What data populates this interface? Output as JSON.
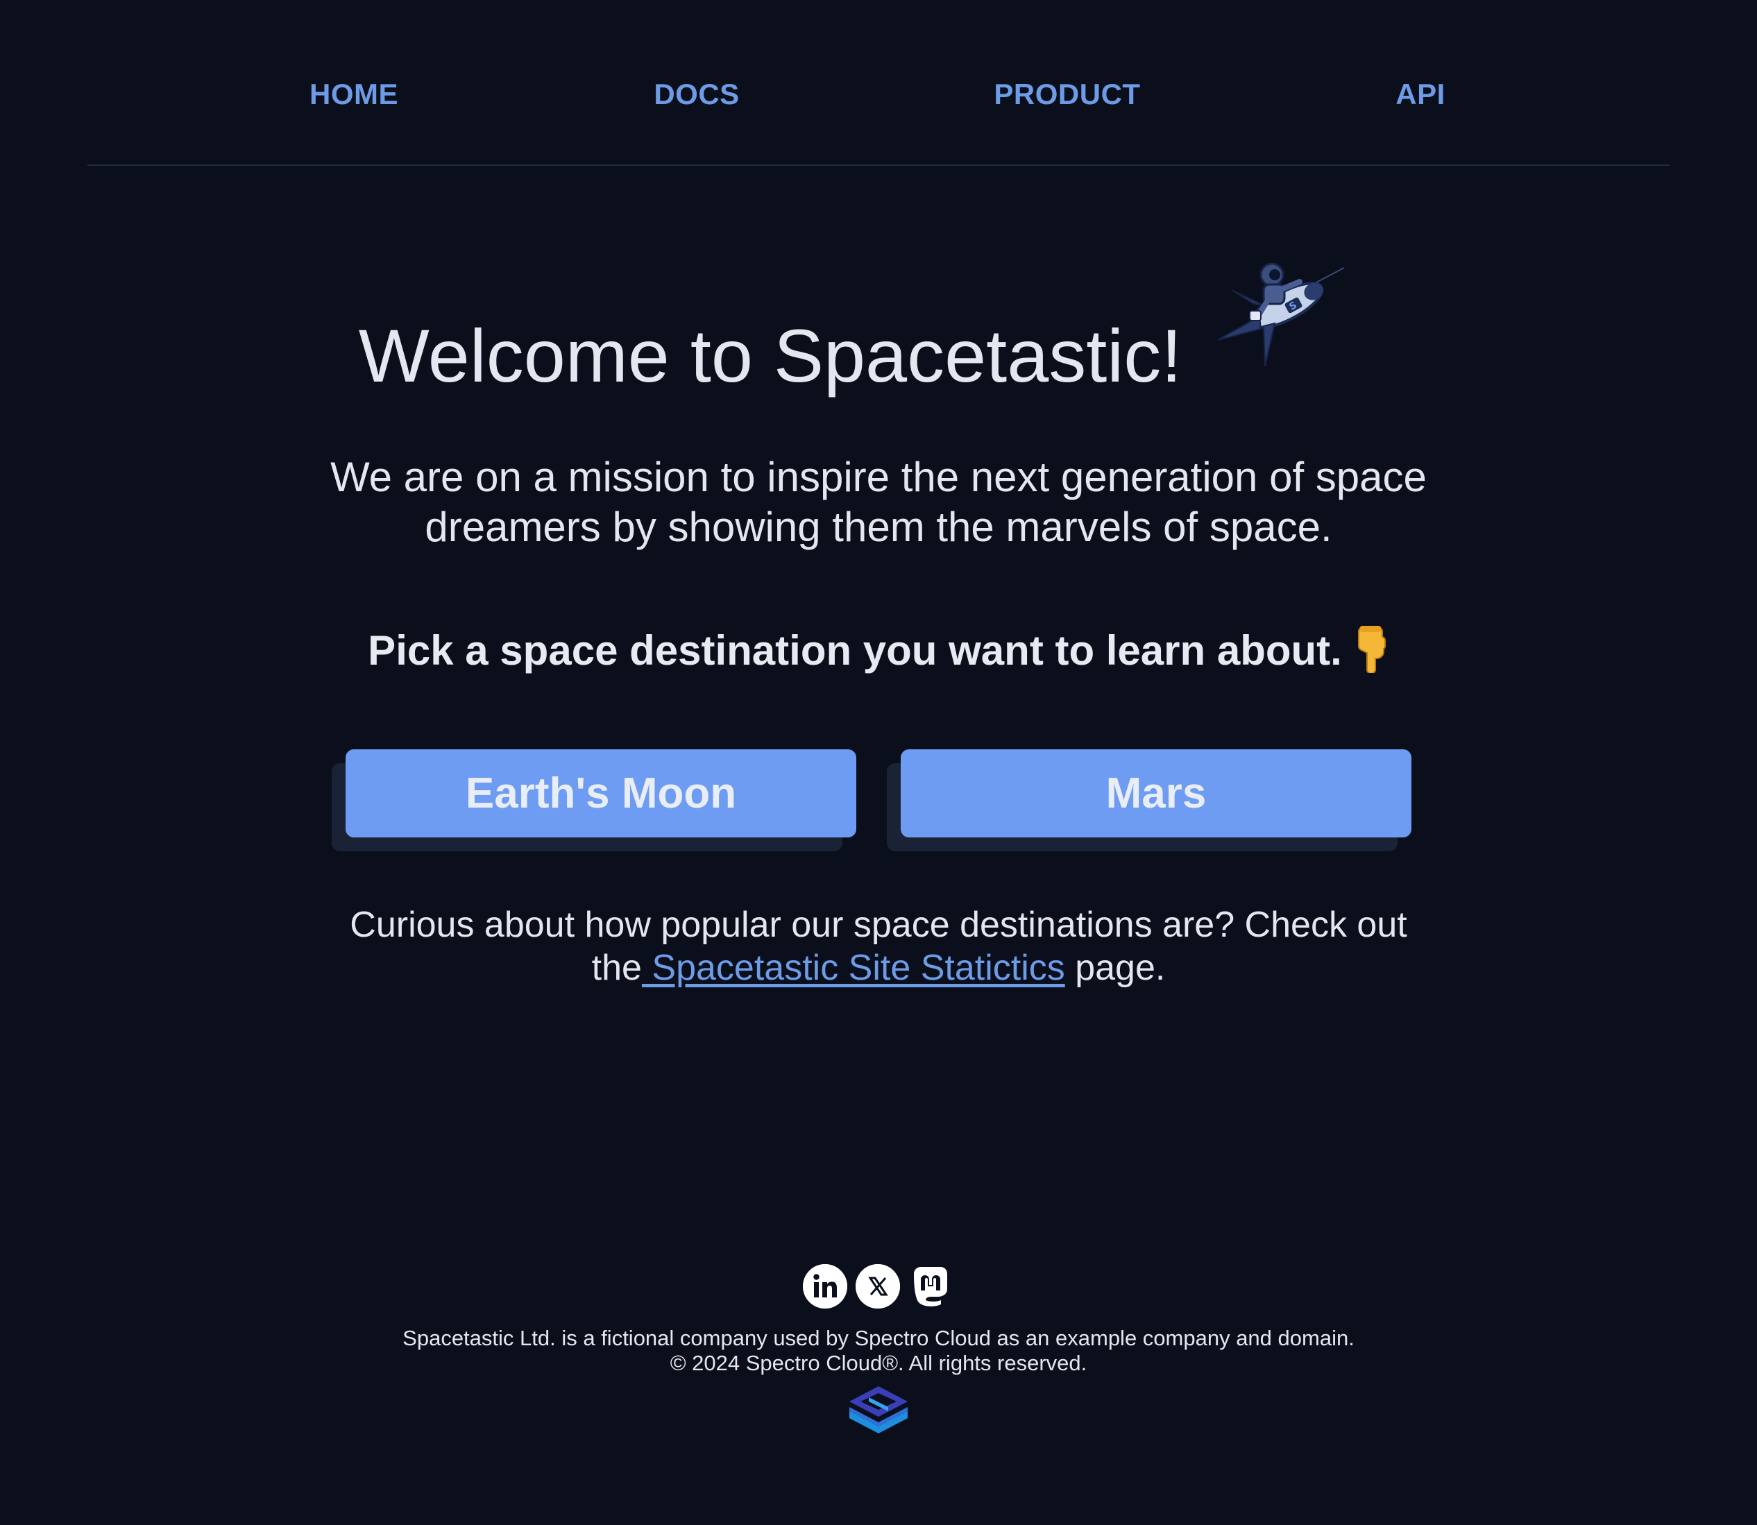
{
  "nav": {
    "home": "HOME",
    "docs": "DOCS",
    "product": "PRODUCT",
    "api": "API"
  },
  "hero": {
    "title": "Welcome to Spacetastic!",
    "mission": "We are on a mission to inspire the next generation of space dreamers by showing them the marvels of space.",
    "pick": "Pick a space destination you want to learn about.",
    "pick_icon": "pointing-down-hand-icon",
    "rocket_icon": "astronaut-riding-rocket-icon"
  },
  "buttons": {
    "moon": "Earth's Moon",
    "mars": "Mars"
  },
  "curious": {
    "before": "Curious about how popular our space destinations are? Check out the",
    "link": " Spacetastic Site Statictics",
    "after": " page."
  },
  "footer": {
    "socials": [
      "linkedin-icon",
      "x-icon",
      "mastodon-icon"
    ],
    "line1": "Spacetastic Ltd. is a fictional company used by Spectro Cloud as an example company and domain.",
    "line2": "© 2024 Spectro Cloud®. All rights reserved.",
    "logo": "spectro-cloud-logo"
  },
  "colors": {
    "background": "#0b0f1c",
    "accent": "#6e9be6",
    "button": "#6d9cf2",
    "text": "#e4e7f0"
  }
}
